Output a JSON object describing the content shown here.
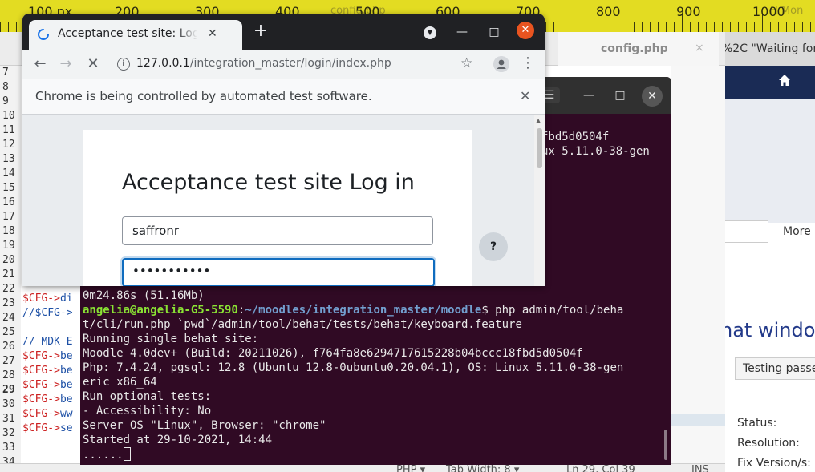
{
  "ruler": {
    "labels": [
      "100 px",
      "200",
      "300",
      "400",
      "500",
      "600",
      "700",
      "800",
      "900",
      "1000"
    ],
    "ghost_left": "config.php",
    "ghost_right": "H Mon"
  },
  "editor": {
    "tab_title": "config.php",
    "tab_close": "×",
    "line_numbers": [
      "7",
      "8",
      "9",
      "10",
      "11",
      "12",
      "13",
      "14",
      "15",
      "16",
      "17",
      "18",
      "19",
      "20",
      "21",
      "22",
      "23",
      "24",
      "25",
      "26",
      "27",
      "28",
      "29",
      "30",
      "31",
      "32",
      "33",
      "34"
    ],
    "current_line": "29",
    "code_lines": [
      {
        "pre": "$CFG->",
        "rest": "di"
      },
      {
        "pre": "//$CFG->",
        "rest": ""
      },
      {
        "pre": "// MDK E",
        "rest": ""
      },
      {
        "pre": "$CFG->",
        "rest": "be"
      },
      {
        "pre": "$CFG->",
        "rest": "be"
      },
      {
        "pre": "$CFG->",
        "rest": "be"
      },
      {
        "pre": "$CFG->",
        "rest": "be"
      },
      {
        "pre": "$CFG->",
        "rest": "ww"
      },
      {
        "pre": "$CFG->",
        "rest": "se"
      }
    ],
    "status_lang": "PHP ▾",
    "status_tab": "Tab Width: 8 ▾",
    "status_pos": "Ln 29, Col 39",
    "status_ins": "INS"
  },
  "right_page": {
    "tab_text": "%2C \"Waiting for",
    "more": "More",
    "heading": "hat window",
    "test_label": "Testing passed",
    "meta": [
      "Status:",
      "Resolution:",
      "Fix Version/s:"
    ]
  },
  "terminal": {
    "menu_icon": "☰",
    "minimize": "—",
    "maximize": "□",
    "close": "✕",
    "upper_lines": [
      "fbd5d0504f",
      "ux 5.11.0-38-gen"
    ],
    "time_line": "0m24.86s (51.16Mb)",
    "prompt_user": "angelia@angelia-G5-5590",
    "prompt_sep": ":",
    "prompt_path": "~/moodles/integration_master/moodle",
    "prompt_cmd": "$ php admin/tool/beha",
    "lines": [
      "t/cli/run.php `pwd`/admin/tool/behat/tests/behat/keyboard.feature",
      "Running single behat site:",
      "Moodle 4.0dev+ (Build: 20211026), f764fa8e6294717615228b04bccc18fbd5d0504f",
      "Php: 7.4.24, pgsql: 12.8 (Ubuntu 12.8-0ubuntu0.20.04.1), OS: Linux 5.11.0-38-gen",
      "eric x86_64",
      "Run optional tests:",
      "- Accessibility: No",
      "Server OS \"Linux\", Browser: \"chrome\"",
      "Started at 29-10-2021, 14:44",
      "......"
    ]
  },
  "chrome": {
    "tab_title": "Acceptance test site: Log in",
    "tab_close": "✕",
    "new_tab": "+",
    "url_host": "127.0.0.1",
    "url_path": "/integration_master/login/index.php",
    "infobar": "Chrome is being controlled by automated test software.",
    "infobar_close": "✕",
    "page_heading": "Acceptance test site Log in",
    "username_value": "saffronr",
    "password_value": "•••••••••••",
    "help": "?"
  }
}
